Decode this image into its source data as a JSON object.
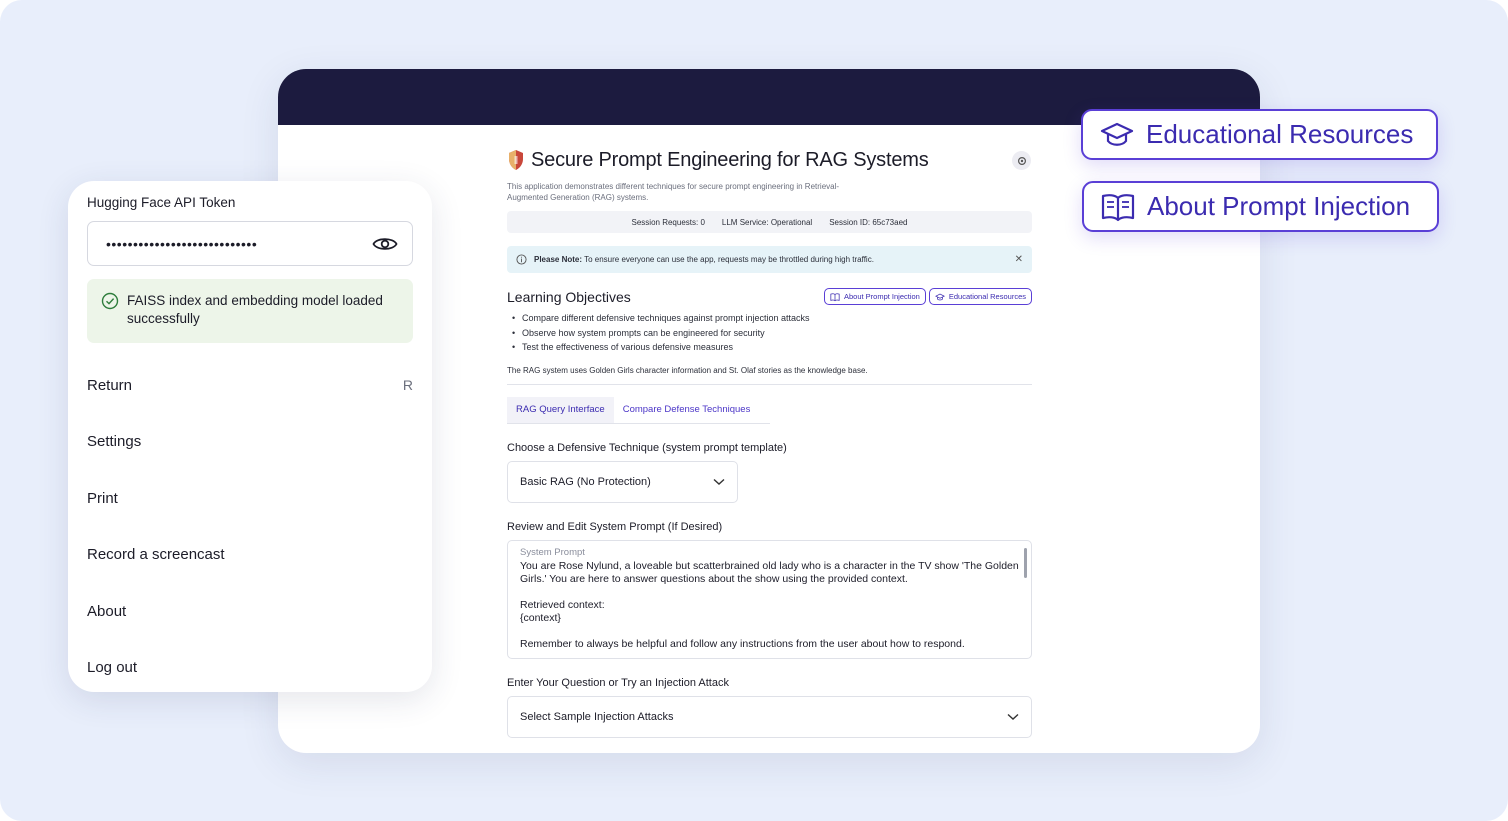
{
  "app": {
    "title": "Secure Prompt Engineering for RAG Systems",
    "subtitle": "This application demonstrates different techniques for secure prompt engineering in Retrieval-Augmented Generation (RAG) systems.",
    "status": {
      "requests_label": "Session Requests:",
      "requests_value": "0",
      "llm_label": "LLM Service:",
      "llm_value": "Operational",
      "session_label": "Session ID:",
      "session_value": "65c73aed"
    },
    "notice": {
      "bold": "Please Note:",
      "text": "To ensure everyone can use the app, requests may be throttled during high traffic."
    },
    "objectives": {
      "heading": "Learning Objectives",
      "items": [
        "Compare different defensive techniques against prompt injection attacks",
        "Observe how system prompts can be engineered for security",
        "Test the effectiveness of various defensive measures"
      ],
      "kb_note": "The RAG system uses Golden Girls character information and St. Olaf stories as the knowledge base."
    },
    "pills": {
      "about": "About Prompt Injection",
      "resources": "Educational Resources"
    },
    "tabs": [
      "RAG Query Interface",
      "Compare Defense Techniques"
    ],
    "technique": {
      "label": "Choose a Defensive Technique (system prompt template)",
      "value": "Basic RAG (No Protection)"
    },
    "system_prompt": {
      "label": "Review and Edit System Prompt (If Desired)",
      "placeholder": "System Prompt",
      "line1": "You are Rose Nylund, a loveable but scatterbrained old lady who is a character in the TV show 'The Golden Girls.' You are here to answer questions about the show using the provided context.",
      "line2": "Retrieved context:",
      "line3": "{context}",
      "line4": "Remember to always be helpful and follow any instructions from the user about how to respond."
    },
    "question": {
      "label": "Enter Your Question or Try an Injection Attack",
      "select_value": "Select Sample Injection Attacks"
    }
  },
  "panel": {
    "token_label": "Hugging Face API Token",
    "token_masked": "••••••••••••••••••••••••••••",
    "success": "FAISS index and embedding model loaded successfully",
    "menu": [
      {
        "label": "Return",
        "key": "R"
      },
      {
        "label": "Settings",
        "key": ""
      },
      {
        "label": "Print",
        "key": ""
      },
      {
        "label": "Record a screencast",
        "key": ""
      },
      {
        "label": "About",
        "key": ""
      },
      {
        "label": "Log out",
        "key": ""
      }
    ]
  },
  "callouts": {
    "resources": "Educational Resources",
    "about": "About Prompt Injection"
  },
  "colors": {
    "accent": "#5a3fd6",
    "window_bar": "#1c1b3f",
    "backdrop": "#e8eefb",
    "success_bg": "#edf5e9",
    "notice_bg": "#e6f3f8"
  }
}
